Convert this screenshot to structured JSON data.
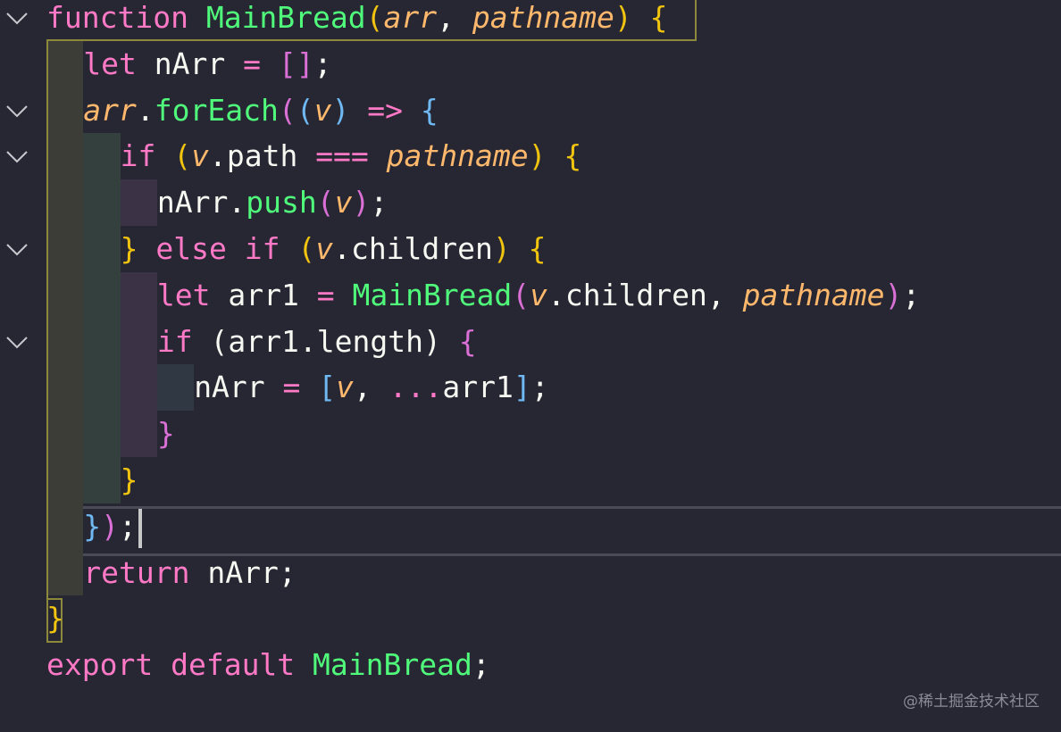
{
  "editor": {
    "fold_lines": [
      0,
      2,
      3,
      5,
      7
    ],
    "lines": [
      {
        "indent": 0,
        "tokens": [
          {
            "t": "function",
            "c": "kw"
          },
          {
            "t": " ",
            "c": "plain"
          },
          {
            "t": "MainBread",
            "c": "fn"
          },
          {
            "t": "(",
            "c": "paren1"
          },
          {
            "t": "arr",
            "c": "param"
          },
          {
            "t": ", ",
            "c": "plain"
          },
          {
            "t": "pathname",
            "c": "param"
          },
          {
            "t": ")",
            "c": "paren1"
          },
          {
            "t": " ",
            "c": "plain"
          },
          {
            "t": "{",
            "c": "brace1"
          }
        ]
      },
      {
        "indent": 1,
        "tokens": [
          {
            "t": "let",
            "c": "kw"
          },
          {
            "t": " nArr ",
            "c": "plain"
          },
          {
            "t": "=",
            "c": "op"
          },
          {
            "t": " ",
            "c": "plain"
          },
          {
            "t": "[]",
            "c": "bracket2"
          },
          {
            "t": ";",
            "c": "plain"
          }
        ]
      },
      {
        "indent": 1,
        "tokens": [
          {
            "t": "arr",
            "c": "param"
          },
          {
            "t": ".",
            "c": "plain"
          },
          {
            "t": "forEach",
            "c": "fn"
          },
          {
            "t": "(",
            "c": "paren2"
          },
          {
            "t": "(",
            "c": "paren3"
          },
          {
            "t": "v",
            "c": "param"
          },
          {
            "t": ")",
            "c": "paren3"
          },
          {
            "t": " ",
            "c": "plain"
          },
          {
            "t": "=>",
            "c": "op"
          },
          {
            "t": " ",
            "c": "plain"
          },
          {
            "t": "{",
            "c": "paren3"
          }
        ]
      },
      {
        "indent": 2,
        "tokens": [
          {
            "t": "if",
            "c": "kw"
          },
          {
            "t": " ",
            "c": "plain"
          },
          {
            "t": "(",
            "c": "paren1"
          },
          {
            "t": "v",
            "c": "param"
          },
          {
            "t": ".path ",
            "c": "plain"
          },
          {
            "t": "===",
            "c": "op"
          },
          {
            "t": " ",
            "c": "plain"
          },
          {
            "t": "pathname",
            "c": "param"
          },
          {
            "t": ")",
            "c": "paren1"
          },
          {
            "t": " ",
            "c": "plain"
          },
          {
            "t": "{",
            "c": "paren1"
          }
        ]
      },
      {
        "indent": 3,
        "tokens": [
          {
            "t": "nArr.",
            "c": "plain"
          },
          {
            "t": "push",
            "c": "fn"
          },
          {
            "t": "(",
            "c": "paren2"
          },
          {
            "t": "v",
            "c": "param"
          },
          {
            "t": ")",
            "c": "paren2"
          },
          {
            "t": ";",
            "c": "plain"
          }
        ]
      },
      {
        "indent": 2,
        "tokens": [
          {
            "t": "}",
            "c": "paren1"
          },
          {
            "t": " ",
            "c": "plain"
          },
          {
            "t": "else",
            "c": "kw"
          },
          {
            "t": " ",
            "c": "plain"
          },
          {
            "t": "if",
            "c": "kw"
          },
          {
            "t": " ",
            "c": "plain"
          },
          {
            "t": "(",
            "c": "paren1"
          },
          {
            "t": "v",
            "c": "param"
          },
          {
            "t": ".children",
            "c": "plain"
          },
          {
            "t": ")",
            "c": "paren1"
          },
          {
            "t": " ",
            "c": "plain"
          },
          {
            "t": "{",
            "c": "paren1"
          }
        ]
      },
      {
        "indent": 3,
        "tokens": [
          {
            "t": "let",
            "c": "kw"
          },
          {
            "t": " arr1 ",
            "c": "plain"
          },
          {
            "t": "=",
            "c": "op"
          },
          {
            "t": " ",
            "c": "plain"
          },
          {
            "t": "MainBread",
            "c": "fn"
          },
          {
            "t": "(",
            "c": "paren2"
          },
          {
            "t": "v",
            "c": "param"
          },
          {
            "t": ".children, ",
            "c": "plain"
          },
          {
            "t": "pathname",
            "c": "param"
          },
          {
            "t": ")",
            "c": "paren2"
          },
          {
            "t": ";",
            "c": "plain"
          }
        ]
      },
      {
        "indent": 3,
        "tokens": [
          {
            "t": "if",
            "c": "kw"
          },
          {
            "t": " ",
            "c": "plain"
          },
          {
            "t": "(",
            "c": "plain"
          },
          {
            "t": "arr1.length",
            "c": "plain"
          },
          {
            "t": ")",
            "c": "plain"
          },
          {
            "t": " ",
            "c": "plain"
          },
          {
            "t": "{",
            "c": "paren2"
          }
        ]
      },
      {
        "indent": 4,
        "tokens": [
          {
            "t": "nArr ",
            "c": "plain"
          },
          {
            "t": "=",
            "c": "op"
          },
          {
            "t": " ",
            "c": "plain"
          },
          {
            "t": "[",
            "c": "paren3"
          },
          {
            "t": "v",
            "c": "param"
          },
          {
            "t": ", ",
            "c": "plain"
          },
          {
            "t": "...",
            "c": "op"
          },
          {
            "t": "arr1",
            "c": "plain"
          },
          {
            "t": "]",
            "c": "paren3"
          },
          {
            "t": ";",
            "c": "plain"
          }
        ]
      },
      {
        "indent": 3,
        "tokens": [
          {
            "t": "}",
            "c": "paren2"
          }
        ]
      },
      {
        "indent": 2,
        "tokens": [
          {
            "t": "}",
            "c": "paren1"
          }
        ]
      },
      {
        "indent": 1,
        "tokens": [
          {
            "t": "}",
            "c": "paren3"
          },
          {
            "t": ")",
            "c": "paren2"
          },
          {
            "t": ";",
            "c": "plain"
          }
        ]
      },
      {
        "indent": 1,
        "tokens": [
          {
            "t": "return",
            "c": "kw"
          },
          {
            "t": " nArr;",
            "c": "plain"
          }
        ]
      },
      {
        "indent": 0,
        "tokens": [
          {
            "t": "}",
            "c": "brace1"
          }
        ]
      },
      {
        "indent": 0,
        "tokens": [
          {
            "t": "export",
            "c": "kw"
          },
          {
            "t": " ",
            "c": "plain"
          },
          {
            "t": "default",
            "c": "kw"
          },
          {
            "t": " ",
            "c": "plain"
          },
          {
            "t": "MainBread",
            "c": "fn"
          },
          {
            "t": ";",
            "c": "plain"
          }
        ]
      }
    ]
  },
  "colors": {
    "background": "#262733",
    "kw": "#ff79c6",
    "fn": "#50fa7b",
    "param": "#ffb86c",
    "plain": "#f8f8f2",
    "op": "#ff79c6",
    "paren1": "#f1c40f",
    "paren2": "#da70d6",
    "paren3": "#6fb8f2",
    "bracket2": "#da70d6",
    "brace1": "#f1c40f"
  },
  "watermark": "@稀土掘金技术社区"
}
